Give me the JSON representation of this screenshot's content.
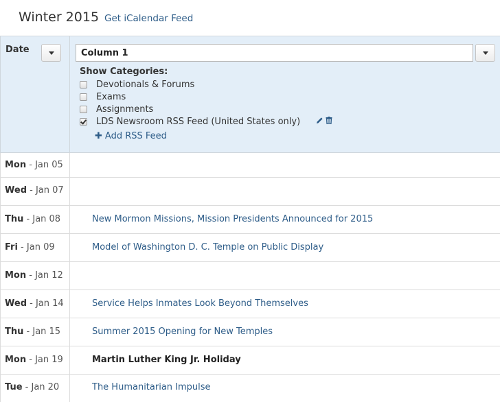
{
  "header": {
    "title": "Winter 2015",
    "ical_link": "Get iCalendar Feed"
  },
  "table_header": {
    "date_label": "Date",
    "column_name": "Column 1",
    "show_categories_label": "Show Categories:",
    "categories": [
      {
        "label": "Devotionals & Forums",
        "checked": false
      },
      {
        "label": "Exams",
        "checked": false
      },
      {
        "label": "Assignments",
        "checked": false
      },
      {
        "label": "LDS Newsroom RSS Feed (United States only)",
        "checked": true
      }
    ],
    "add_rss_label": "Add RSS Feed"
  },
  "rows": [
    {
      "day": "Mon",
      "date": "Jan 05",
      "event": "",
      "event_type": "none"
    },
    {
      "day": "Wed",
      "date": "Jan 07",
      "event": "",
      "event_type": "none"
    },
    {
      "day": "Thu",
      "date": "Jan 08",
      "event": "New Mormon Missions, Mission Presidents Announced for 2015",
      "event_type": "link"
    },
    {
      "day": "Fri",
      "date": "Jan 09",
      "event": "Model of Washington D. C. Temple on Public Display",
      "event_type": "link"
    },
    {
      "day": "Mon",
      "date": "Jan 12",
      "event": "",
      "event_type": "none"
    },
    {
      "day": "Wed",
      "date": "Jan 14",
      "event": "Service Helps Inmates Look Beyond Themselves",
      "event_type": "link"
    },
    {
      "day": "Thu",
      "date": "Jan 15",
      "event": "Summer 2015 Opening for New Temples",
      "event_type": "link"
    },
    {
      "day": "Mon",
      "date": "Jan 19",
      "event": "Martin Luther King Jr. Holiday",
      "event_type": "holiday"
    },
    {
      "day": "Tue",
      "date": "Jan 20",
      "event": "The Humanitarian Impulse",
      "event_type": "link"
    }
  ],
  "colors": {
    "link": "#2d5c88",
    "header_bg": "#e3eef8",
    "text": "#333333"
  }
}
